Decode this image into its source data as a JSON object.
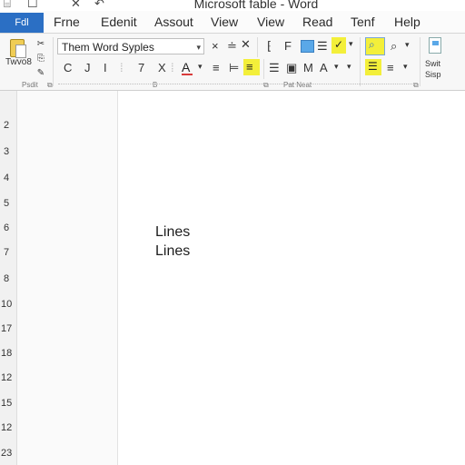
{
  "window": {
    "title": "Microsoft fable - Word"
  },
  "quick_access": [
    "⌸",
    "☐",
    "✕",
    "↶"
  ],
  "tabs": [
    {
      "label": "Fdl"
    },
    {
      "label": "Frne"
    },
    {
      "label": "Edenit"
    },
    {
      "label": "Assout"
    },
    {
      "label": "View"
    },
    {
      "label": "View"
    },
    {
      "label": "Read"
    },
    {
      "label": "Tenf"
    },
    {
      "label": "Help"
    }
  ],
  "ribbon": {
    "clipboard": {
      "paste_label": "Twvo8",
      "group_label": "Psdit"
    },
    "font": {
      "font_name": "Them Word Syples",
      "buttons_row2": [
        "C",
        "J",
        "I",
        "7",
        "X",
        "A"
      ],
      "group_label": "B"
    },
    "paragraph": {
      "group_label": "Pat Neat"
    },
    "styles": {
      "switch_label_1": "Swit",
      "switch_label_2": "Sisp"
    }
  },
  "ruler": {
    "numbers": [
      "2",
      "3",
      "4",
      "5",
      "6",
      "7",
      "8",
      "10",
      "17",
      "18",
      "12",
      "15",
      "12",
      "23"
    ]
  },
  "document": {
    "lines": [
      "Lines",
      "Lines"
    ]
  },
  "colors": {
    "file_tab": "#2b6fc4",
    "highlight_yellow": "#f3ef3a",
    "font_color_red": "#d83b3b"
  }
}
